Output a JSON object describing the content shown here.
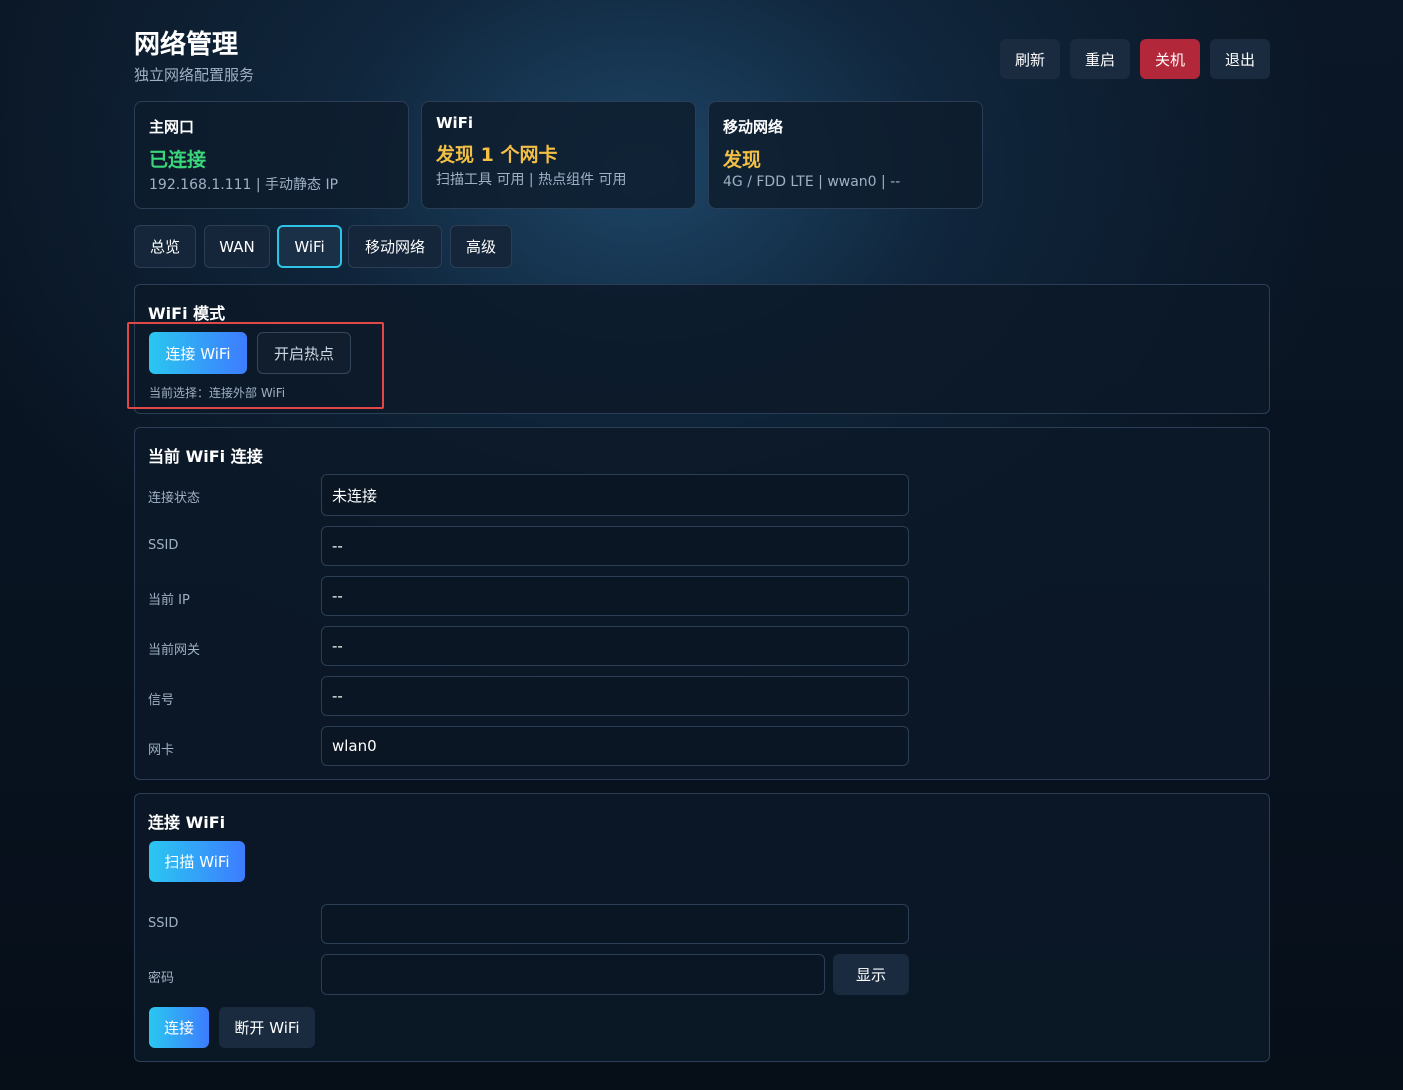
{
  "header": {
    "title": "网络管理",
    "subtitle": "独立网络配置服务",
    "buttons": {
      "refresh": "刷新",
      "reboot": "重启",
      "shutdown": "关机",
      "logout": "退出"
    }
  },
  "cards": [
    {
      "label": "主网口",
      "value": "已连接",
      "detail": "192.168.1.111 | 手动静态 IP"
    },
    {
      "label": "WiFi",
      "value": "发现 1 个网卡",
      "detail": "扫描工具 可用 | 热点组件 可用"
    },
    {
      "label": "移动网络",
      "value": "发现",
      "detail": "4G / FDD LTE | wwan0 | --"
    }
  ],
  "tabs": [
    "总览",
    "WAN",
    "WiFi",
    "移动网络",
    "高级"
  ],
  "active_tab": "WiFi",
  "wifi_mode": {
    "title": "WiFi 模式",
    "connect_label": "连接 WiFi",
    "hotspot_label": "开启热点",
    "current_selection": "当前选择：连接外部 WiFi"
  },
  "current_connection": {
    "title": "当前 WiFi 连接",
    "fields": [
      {
        "label": "连接状态",
        "value": "未连接"
      },
      {
        "label": "SSID",
        "value": "--"
      },
      {
        "label": "当前 IP",
        "value": "--"
      },
      {
        "label": "当前网关",
        "value": "--"
      },
      {
        "label": "信号",
        "value": "--"
      },
      {
        "label": "网卡",
        "value": "wlan0"
      }
    ]
  },
  "connect_wifi": {
    "title": "连接 WiFi",
    "scan_label": "扫描 WiFi",
    "ssid_label": "SSID",
    "ssid_value": "",
    "password_label": "密码",
    "password_value": "",
    "show_label": "显示",
    "connect_label": "连接",
    "disconnect_label": "断开 WiFi"
  }
}
